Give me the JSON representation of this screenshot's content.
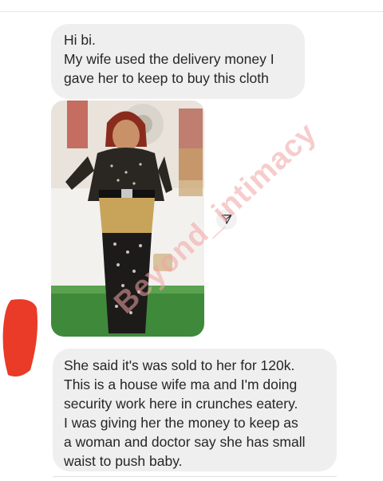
{
  "conversation": {
    "message_1": "Hi bi.\nMy wife used the delivery money I\ngave her to keep to buy this cloth",
    "message_2": "She said it's was sold to her for 120k.\nThis is a house wife ma and I'm doing\nsecurity work here in crunches eatery.\nI was giving her the money to keep as\na woman and doctor say she has small\nwaist to push baby."
  },
  "watermark": {
    "text": "Beyond_intimacy"
  },
  "icons": {
    "share": "send-arrow-icon"
  },
  "colors": {
    "bubble": "#efefef",
    "text": "#262626",
    "watermark": "#f2a4a4",
    "mark": "#e8301b"
  }
}
